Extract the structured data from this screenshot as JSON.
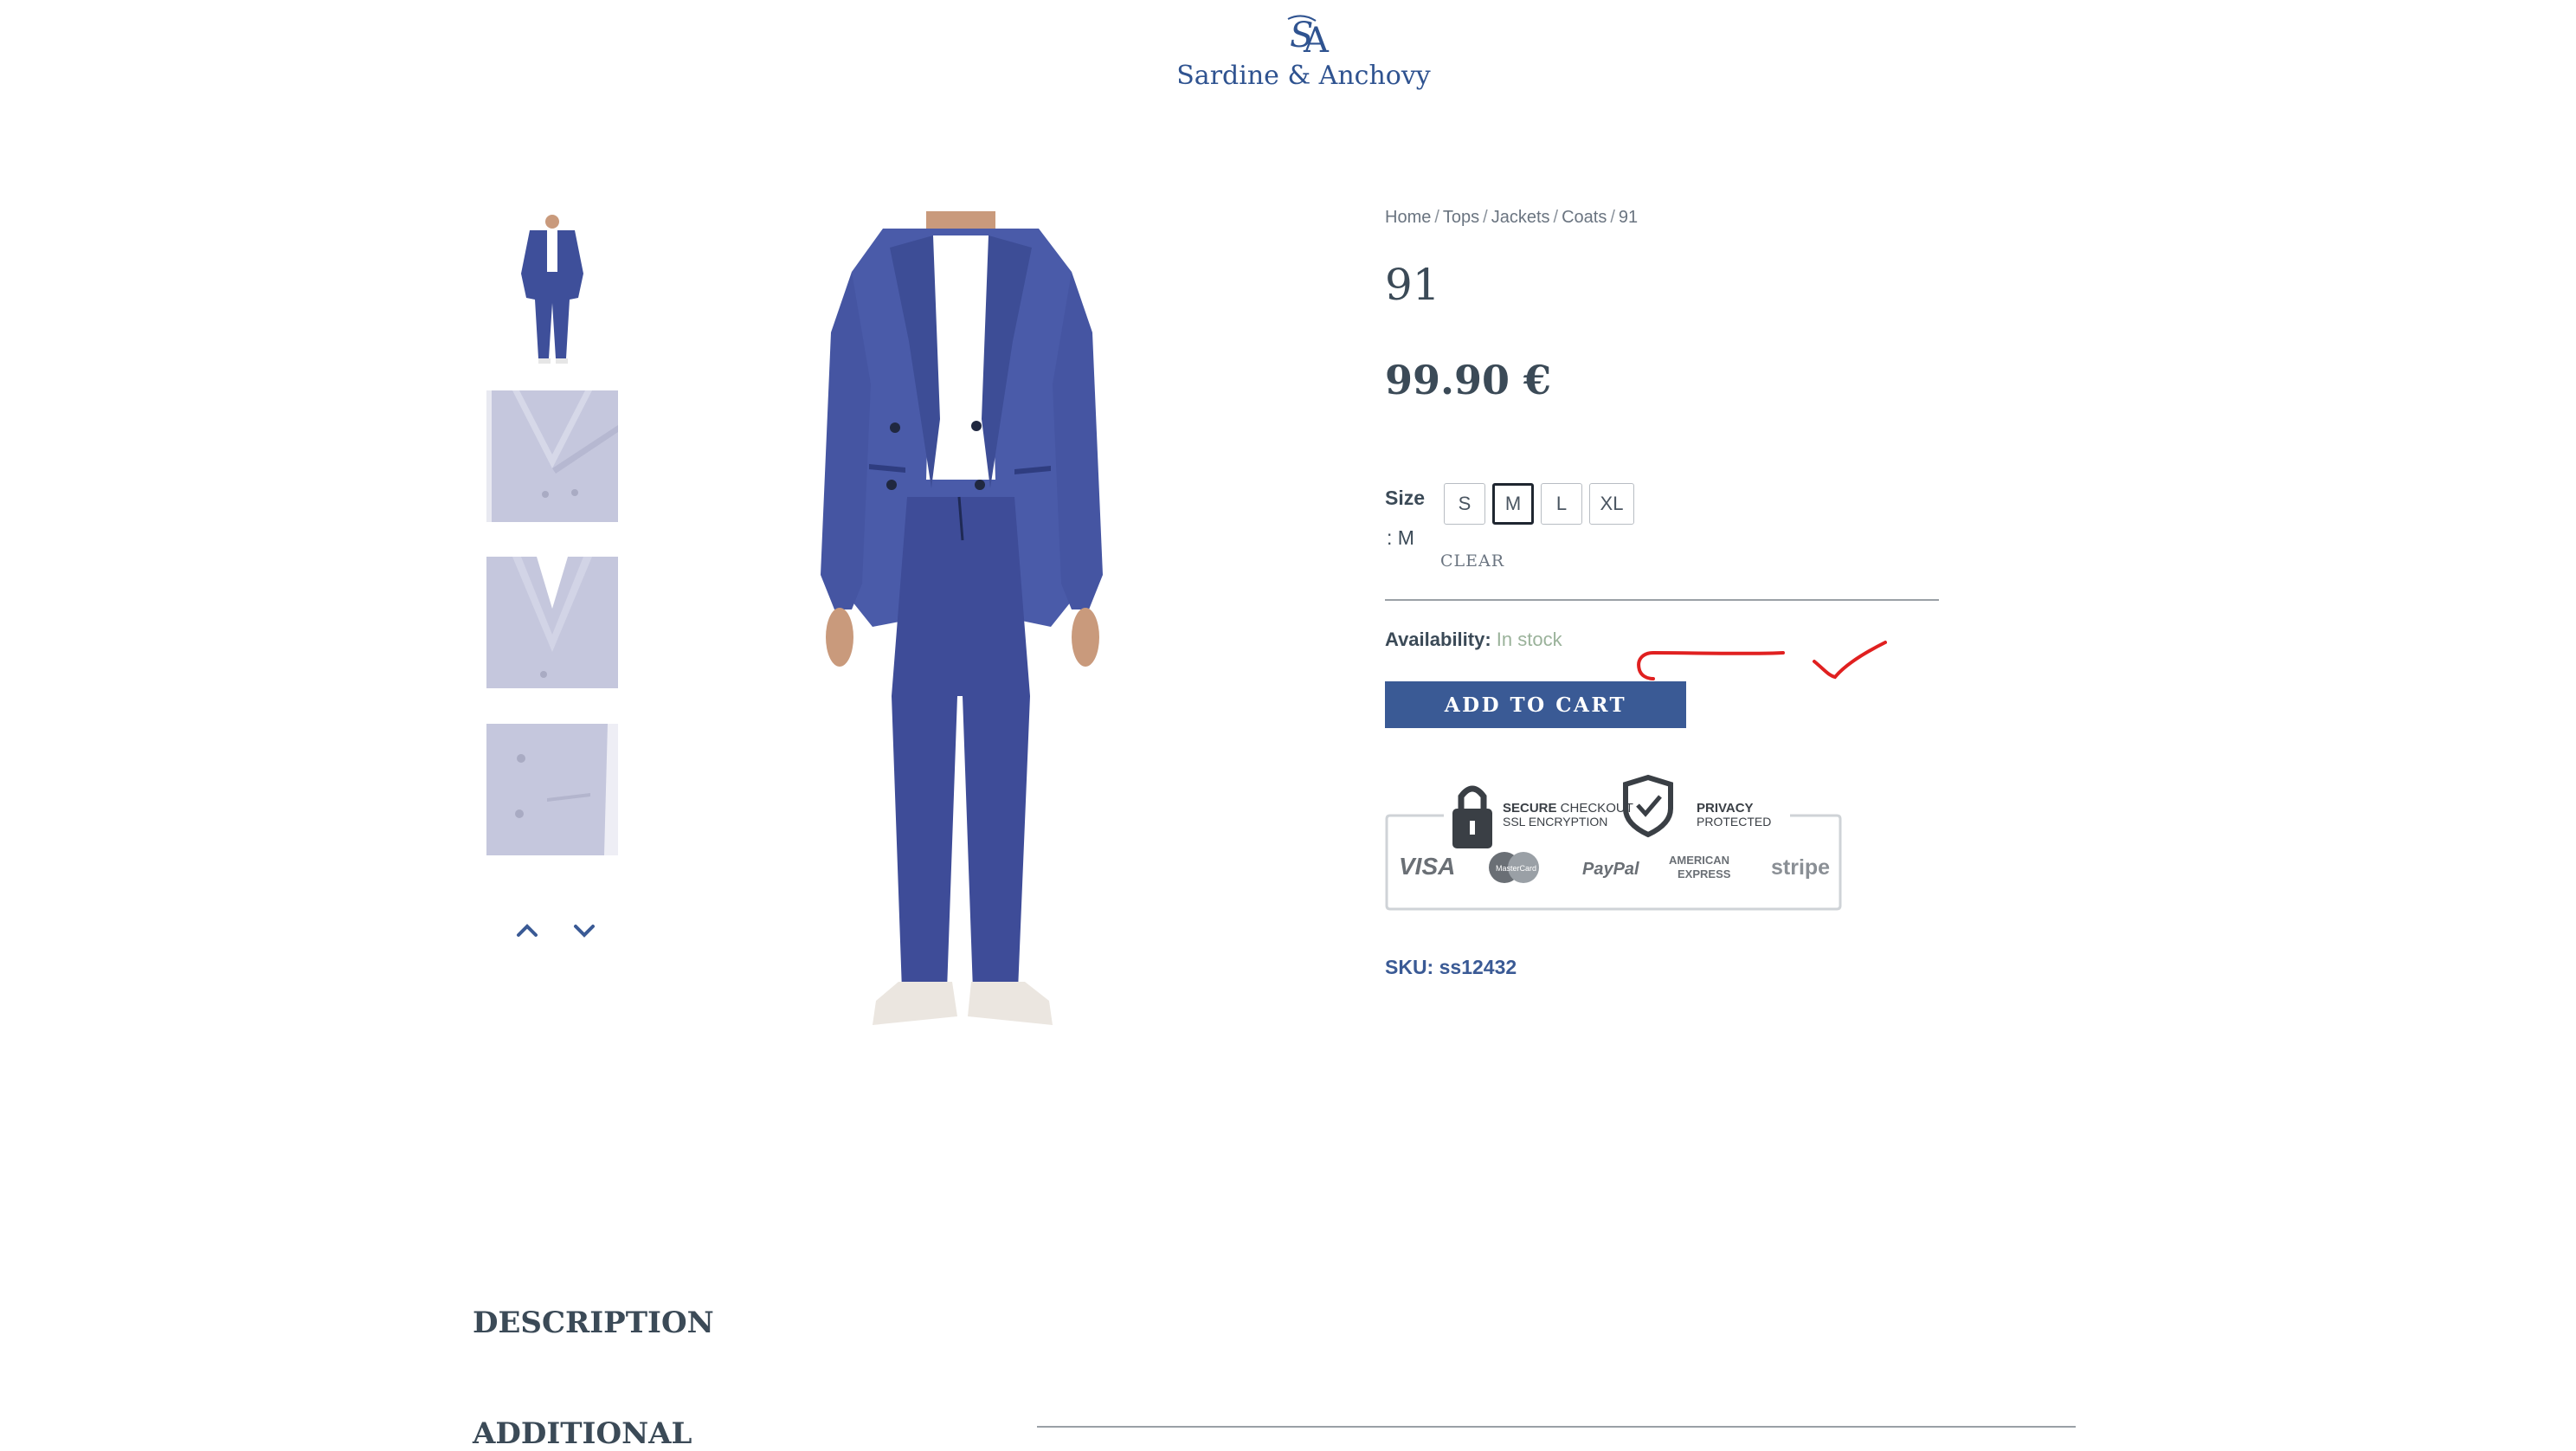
{
  "brand": {
    "name": "Sardine & Anchovy",
    "monogram": "SA",
    "logo_color": "#2f5390"
  },
  "gallery": {
    "thumbnails": [
      {
        "alt": "Blue double-breasted suit, full view"
      },
      {
        "alt": "Jacket lapel detail"
      },
      {
        "alt": "Jacket collar detail"
      },
      {
        "alt": "Jacket button detail"
      }
    ],
    "nav": {
      "up_icon": "chevron-up-icon",
      "down_icon": "chevron-down-icon"
    },
    "main_image_alt": "Man wearing blue double-breasted suit with white t-shirt and sneakers"
  },
  "breadcrumb": {
    "items": [
      "Home",
      "Tops",
      "Jackets",
      "Coats",
      "91"
    ],
    "separator": "/"
  },
  "product": {
    "title": "91",
    "price": "99.90 €",
    "size_label": "Size",
    "size_selected": ": M",
    "sizes": [
      "S",
      "M",
      "L",
      "XL"
    ],
    "selected_size": "M",
    "clear_label": "CLEAR",
    "availability_label": "Availability:",
    "availability_value": "In stock",
    "add_to_cart_label": "ADD TO CART",
    "sku": "SKU: ss12432"
  },
  "trust_badge": {
    "secure_bold": "SECURE",
    "secure_rest": " CHECKOUT",
    "secure_sub": "SSL ENCRYPTION",
    "privacy": "PRIVACY",
    "privacy_sub": "PROTECTED",
    "payment_methods": [
      "VISA",
      "MasterCard",
      "PayPal",
      "AMERICAN",
      "EXPRESS",
      "stripe"
    ]
  },
  "sections": {
    "description_heading": "DESCRIPTION",
    "additional_heading": "ADDITIONAL"
  },
  "colors": {
    "accent": "#3a5a95",
    "text": "#3b4a57",
    "in_stock": "#9ab29a",
    "annotation": "#e02020"
  }
}
